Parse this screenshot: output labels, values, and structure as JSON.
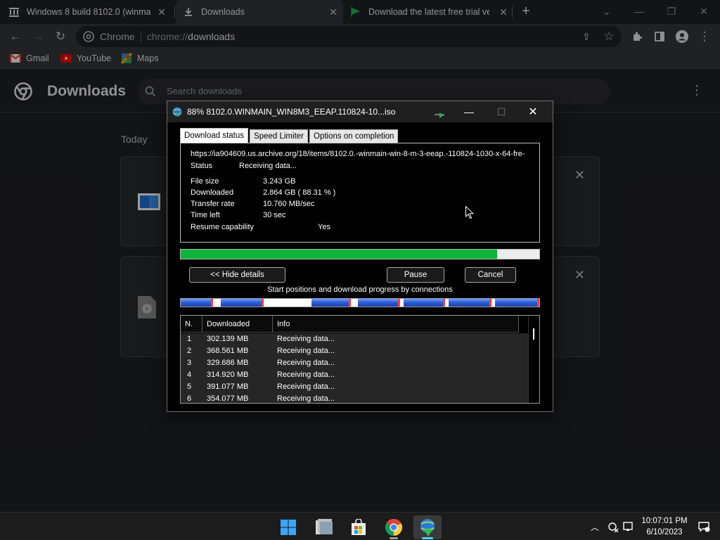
{
  "browser": {
    "tabs": [
      {
        "title": "Windows 8 build 8102.0 (winmain",
        "icon": "archive-icon",
        "active": false
      },
      {
        "title": "Downloads",
        "icon": "download-icon",
        "active": true
      },
      {
        "title": "Download the latest free trial ver",
        "icon": "idm-flag-icon",
        "active": false
      }
    ],
    "omnibox": {
      "site_label": "Chrome",
      "url_scheme": "chrome://",
      "url_host": "downloads"
    },
    "bookmarks": [
      {
        "label": "Gmail",
        "icon": "gmail-icon"
      },
      {
        "label": "YouTube",
        "icon": "youtube-icon"
      },
      {
        "label": "Maps",
        "icon": "maps-icon"
      }
    ]
  },
  "downloads_page": {
    "title": "Downloads",
    "search_placeholder": "Search downloads",
    "section_label": "Today"
  },
  "idm": {
    "window_title": "88% 8102.0.WINMAIN_WIN8M3_EEAP.110824-10...iso",
    "tabs": [
      "Download status",
      "Speed Limiter",
      "Options on completion"
    ],
    "active_tab": 0,
    "url": "https://ia904609.us.archive.org/18/items/8102.0.-winmain-win-8-m-3-eeap.-110824-1030-x-64-fre-",
    "status": {
      "label": "Status",
      "value": "Receiving data..."
    },
    "file_size": {
      "label": "File size",
      "value": "3.243  GB"
    },
    "downloaded": {
      "label": "Downloaded",
      "value": "2.864  GB  ( 88.31 % )"
    },
    "transfer_rate": {
      "label": "Transfer rate",
      "value": "10.760  MB/sec"
    },
    "time_left": {
      "label": "Time left",
      "value": "30 sec"
    },
    "resume": {
      "label": "Resume capability",
      "value": "Yes"
    },
    "progress_fraction": 0.8831,
    "buttons": {
      "hide_details": "<< Hide details",
      "pause": "Pause",
      "cancel": "Cancel"
    },
    "connections_caption": "Start positions and download progress by connections",
    "connection_segments": [
      {
        "start": 0.0,
        "progress": 0.09
      },
      {
        "start": 0.111,
        "progress": 0.12
      },
      {
        "start": 0.365,
        "progress": 0.11
      },
      {
        "start": 0.495,
        "progress": 0.118
      },
      {
        "start": 0.621,
        "progress": 0.116
      },
      {
        "start": 0.748,
        "progress": 0.12
      },
      {
        "start": 0.876,
        "progress": 0.124
      }
    ],
    "table": {
      "headers": [
        "N.",
        "Downloaded",
        "Info"
      ],
      "rows": [
        {
          "n": "1",
          "downloaded": "302.139  MB",
          "info": "Receiving data..."
        },
        {
          "n": "2",
          "downloaded": "368.561  MB",
          "info": "Receiving data..."
        },
        {
          "n": "3",
          "downloaded": "329.686  MB",
          "info": "Receiving data..."
        },
        {
          "n": "4",
          "downloaded": "314.920  MB",
          "info": "Receiving data..."
        },
        {
          "n": "5",
          "downloaded": "391.077  MB",
          "info": "Receiving data..."
        },
        {
          "n": "6",
          "downloaded": "354.077  MB",
          "info": "Receiving data..."
        }
      ]
    }
  },
  "taskbar": {
    "apps": [
      "windows-start-icon",
      "file-explorer-icon",
      "microsoft-store-icon",
      "chrome-icon",
      "idm-icon"
    ],
    "time": "10:07:01 PM",
    "date": "6/10/2023"
  },
  "colors": {
    "progress_green": "#0eb43a",
    "segment_blue": "#2e5fd8",
    "chrome_dark": "#202124"
  }
}
